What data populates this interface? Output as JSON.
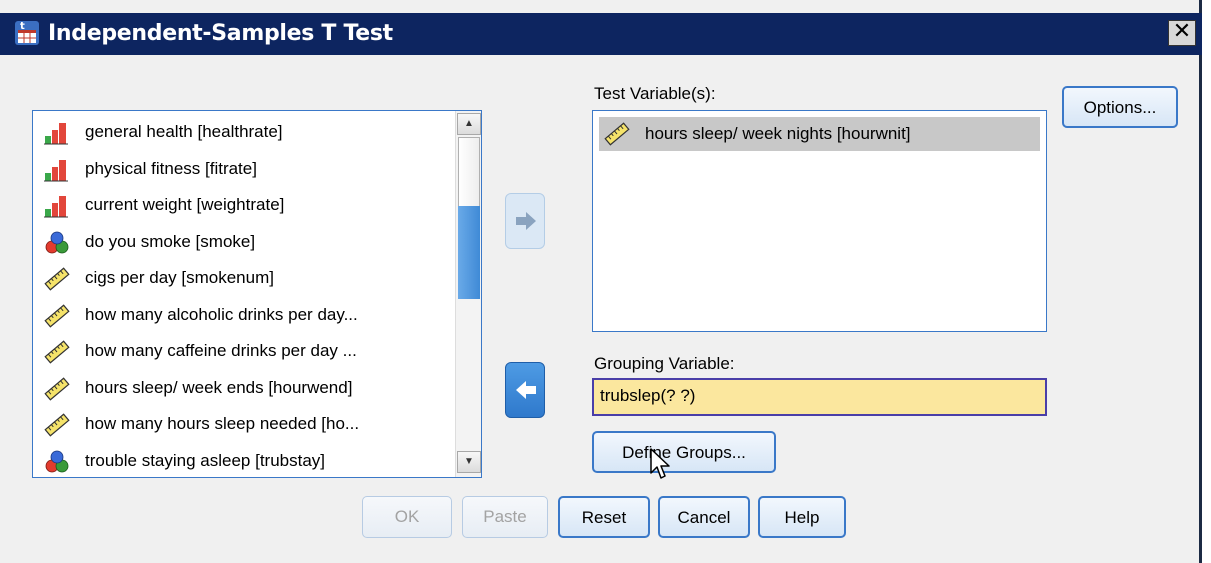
{
  "window": {
    "title": "Independent-Samples T Test",
    "close_label": "✕"
  },
  "source_list": {
    "items": [
      {
        "label": "general health [healthrate]",
        "icon": "ordinal-bar-icon"
      },
      {
        "label": "physical fitness [fitrate]",
        "icon": "ordinal-bar-icon"
      },
      {
        "label": "current weight [weightrate]",
        "icon": "ordinal-bar-icon"
      },
      {
        "label": "do you smoke [smoke]",
        "icon": "nominal-balls-icon"
      },
      {
        "label": "cigs per day  [smokenum]",
        "icon": "scale-ruler-icon"
      },
      {
        "label": "how  many alcoholic drinks per day...",
        "icon": "scale-ruler-icon"
      },
      {
        "label": "how many caffeine drinks per day ...",
        "icon": "scale-ruler-icon"
      },
      {
        "label": "hours sleep/ week ends [hourwend]",
        "icon": "scale-ruler-icon"
      },
      {
        "label": "how many hours sleep needed [ho...",
        "icon": "scale-ruler-icon"
      },
      {
        "label": "trouble staying asleep [trubstay]",
        "icon": "nominal-balls-icon"
      }
    ]
  },
  "test_variables": {
    "label": "Test Variable(s):",
    "items": [
      {
        "label": "hours sleep/ week nights [hourwnit]",
        "icon": "scale-ruler-icon"
      }
    ]
  },
  "grouping": {
    "label": "Grouping Variable:",
    "value": "trubslep(? ?)"
  },
  "buttons": {
    "options": "Options...",
    "define_groups": "Define Groups...",
    "ok": "OK",
    "paste": "Paste",
    "reset": "Reset",
    "cancel": "Cancel",
    "help": "Help"
  },
  "colors": {
    "titlebar": "#0d2560",
    "accent_border": "#3a78c8",
    "grouping_field_bg": "#fbe79e",
    "selection_bg": "#c8c8c8"
  }
}
